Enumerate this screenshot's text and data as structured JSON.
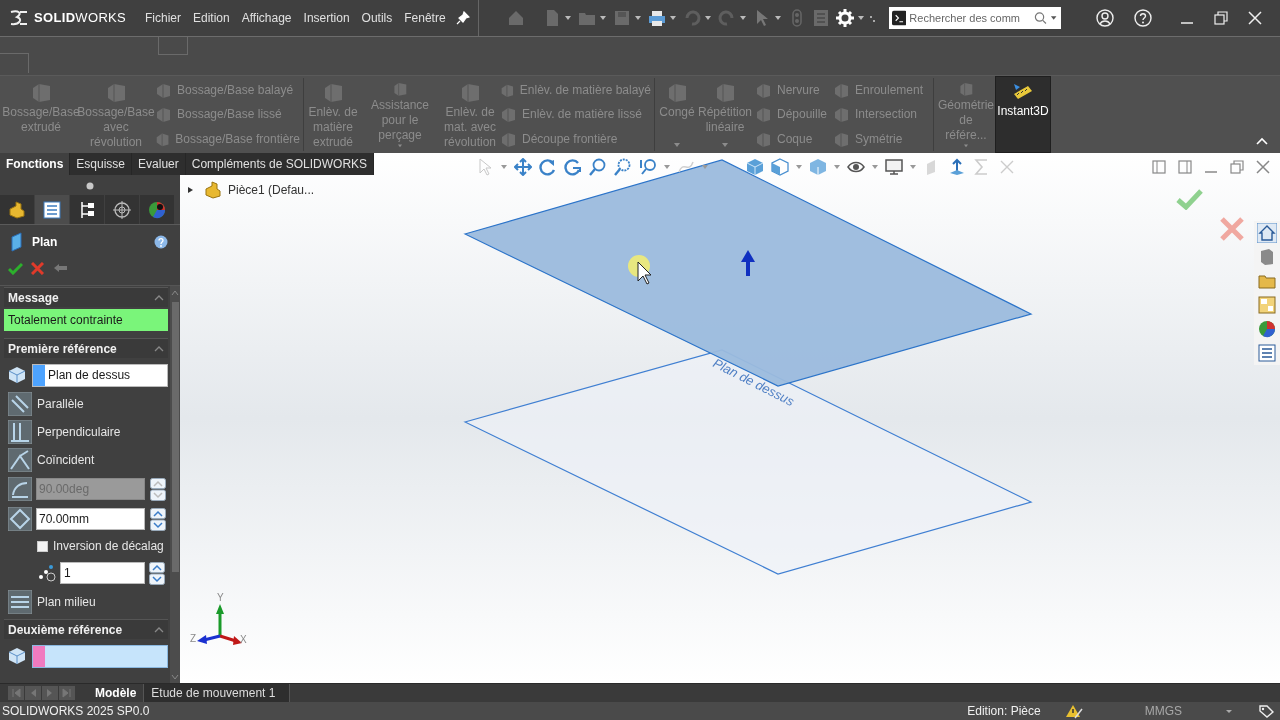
{
  "title_bar": {
    "logo": "**SOLID**WORKS",
    "menu": [
      "Fichier",
      "Edition",
      "Affichage",
      "Insertion",
      "Outils",
      "Fenêtre"
    ],
    "search": {
      "placeholder": "Rechercher des comm"
    }
  },
  "ribbon": [
    {
      "kind": "large",
      "label": "Bossage/Base extrudé",
      "disabled": true,
      "dropdown": false
    },
    {
      "kind": "large",
      "label": "Bossage/Base avec révolution",
      "disabled": true,
      "dropdown": false
    },
    {
      "kind": "stack",
      "items": [
        {
          "label": "Bossage/Base balayé",
          "disabled": true
        },
        {
          "label": "Bossage/Base lissé",
          "disabled": true
        },
        {
          "label": "Bossage/Base frontière",
          "disabled": true
        }
      ]
    },
    {
      "kind": "large",
      "label": "Enlèv. de matière extrudé",
      "disabled": true,
      "dropdown": false
    },
    {
      "kind": "large",
      "label": "Assistance pour le perçage",
      "disabled": true,
      "dropdown": true
    },
    {
      "kind": "large",
      "label": "Enlèv. de mat. avec révolution",
      "disabled": true,
      "dropdown": false
    },
    {
      "kind": "stack",
      "items": [
        {
          "label": "Enlèv. de matière balayé",
          "disabled": true
        },
        {
          "label": "Enlèv. de matière lissé",
          "disabled": true
        },
        {
          "label": "Découpe frontière",
          "disabled": true
        }
      ]
    },
    {
      "kind": "large",
      "label": "Congé",
      "disabled": true,
      "dropdown": true
    },
    {
      "kind": "large",
      "label": "Répétition linéaire",
      "disabled": true,
      "dropdown": true
    },
    {
      "kind": "stack",
      "items": [
        {
          "label": "Nervure",
          "disabled": true
        },
        {
          "label": "Dépouille",
          "disabled": true
        },
        {
          "label": "Coque",
          "disabled": true
        }
      ]
    },
    {
      "kind": "stack",
      "items": [
        {
          "label": "Enroulement",
          "disabled": true
        },
        {
          "label": "Intersection",
          "disabled": true
        },
        {
          "label": "Symétrie",
          "disabled": true
        }
      ]
    },
    {
      "kind": "large",
      "label": "Géométrie de référe...",
      "disabled": true,
      "dropdown": true
    },
    {
      "kind": "toggle",
      "label": "Instant3D",
      "on": true
    }
  ],
  "command_tabs": [
    {
      "label": "Fonctions",
      "selected": true
    },
    {
      "label": "Esquisse",
      "selected": false
    },
    {
      "label": "Evaluer",
      "selected": false
    },
    {
      "label": "Compléments de SOLIDWORKS",
      "selected": false
    }
  ],
  "property_manager": {
    "tabs": [
      {
        "selected": false
      },
      {
        "selected": true
      },
      {
        "selected": false
      },
      {
        "selected": false
      },
      {
        "selected": false
      }
    ],
    "title": "Plan",
    "sections": [
      {
        "kind": "message",
        "title": "Message",
        "expanded": true,
        "text": "Totalement contrainte"
      },
      {
        "kind": "reference",
        "title": "Première référence",
        "expanded": true,
        "rows": [
          {
            "kind": "selection",
            "value": "Plan de dessus",
            "color": "#4da3ff",
            "active": false
          },
          {
            "kind": "option",
            "label": "Parallèle"
          },
          {
            "kind": "option",
            "label": "Perpendiculaire"
          },
          {
            "kind": "option",
            "label": "Coïncident"
          },
          {
            "kind": "spin",
            "value": "90.00deg",
            "disabled": true
          },
          {
            "kind": "spin",
            "value": "70.00mm",
            "disabled": false
          },
          {
            "kind": "check",
            "label": "Inversion de décalag",
            "checked": false
          },
          {
            "kind": "count",
            "value": "1"
          },
          {
            "kind": "option",
            "label": "Plan milieu"
          }
        ]
      },
      {
        "kind": "reference",
        "title": "Deuxième référence",
        "expanded": true,
        "rows": [
          {
            "kind": "selection",
            "color": "#f07ac0",
            "active": true
          }
        ]
      }
    ]
  },
  "tree": {
    "root": "Pièce1 (Defau...",
    "expanded": false
  },
  "viewport": {
    "plane_label": "Plan de dessus",
    "axes": [
      "Y",
      "X",
      "Z"
    ]
  },
  "bottom_tabs": [
    {
      "label": "Modèle",
      "selected": true
    },
    {
      "label": "Etude de mouvement 1",
      "selected": false
    }
  ],
  "status_bar": {
    "version": "SOLIDWORKS 2025 SP0.0",
    "mode": "Edition: Pièce",
    "units": "MMGS"
  }
}
